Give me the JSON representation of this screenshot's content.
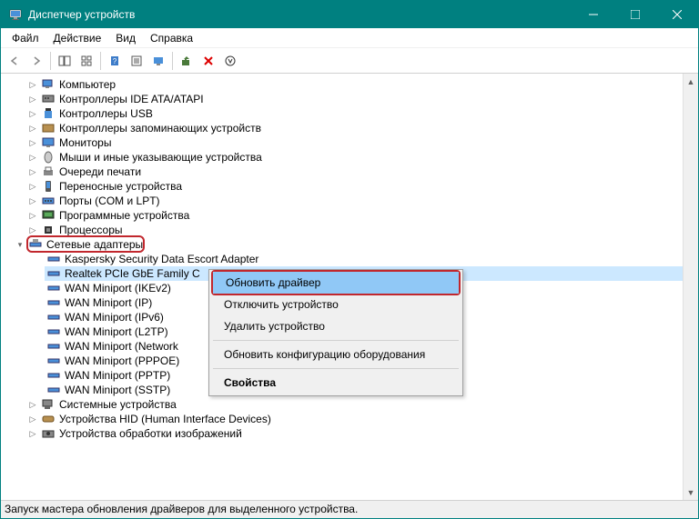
{
  "window": {
    "title": "Диспетчер устройств"
  },
  "menu": {
    "file": "Файл",
    "action": "Действие",
    "view": "Вид",
    "help": "Справка"
  },
  "tree": {
    "items": [
      {
        "label": "Компьютер",
        "icon": "computer"
      },
      {
        "label": "Контроллеры IDE ATA/ATAPI",
        "icon": "ide"
      },
      {
        "label": "Контроллеры USB",
        "icon": "usb"
      },
      {
        "label": "Контроллеры запоминающих устройств",
        "icon": "storage"
      },
      {
        "label": "Мониторы",
        "icon": "monitor"
      },
      {
        "label": "Мыши и иные указывающие устройства",
        "icon": "mouse"
      },
      {
        "label": "Очереди печати",
        "icon": "printer"
      },
      {
        "label": "Переносные устройства",
        "icon": "portable"
      },
      {
        "label": "Порты (COM и LPT)",
        "icon": "port"
      },
      {
        "label": "Программные устройства",
        "icon": "software"
      },
      {
        "label": "Процессоры",
        "icon": "cpu"
      },
      {
        "label": "Сетевые адаптеры",
        "icon": "network",
        "expanded": true,
        "highlighted": true
      },
      {
        "label": "Системные устройства",
        "icon": "system"
      },
      {
        "label": "Устройства HID (Human Interface Devices)",
        "icon": "hid"
      },
      {
        "label": "Устройства обработки изображений",
        "icon": "imaging"
      }
    ],
    "network_children": [
      {
        "label": "Kaspersky Security Data Escort Adapter"
      },
      {
        "label": "Realtek PCIe GbE Family C",
        "selected": true
      },
      {
        "label": "WAN Miniport (IKEv2)"
      },
      {
        "label": "WAN Miniport (IP)"
      },
      {
        "label": "WAN Miniport (IPv6)"
      },
      {
        "label": "WAN Miniport (L2TP)"
      },
      {
        "label": "WAN Miniport (Network"
      },
      {
        "label": "WAN Miniport (PPPOE)"
      },
      {
        "label": "WAN Miniport (PPTP)"
      },
      {
        "label": "WAN Miniport (SSTP)"
      }
    ]
  },
  "context_menu": {
    "update_driver": "Обновить драйвер",
    "disable_device": "Отключить устройство",
    "uninstall_device": "Удалить устройство",
    "scan_hardware": "Обновить конфигурацию оборудования",
    "properties": "Свойства"
  },
  "statusbar": {
    "text": "Запуск мастера обновления драйверов для выделенного устройства."
  }
}
